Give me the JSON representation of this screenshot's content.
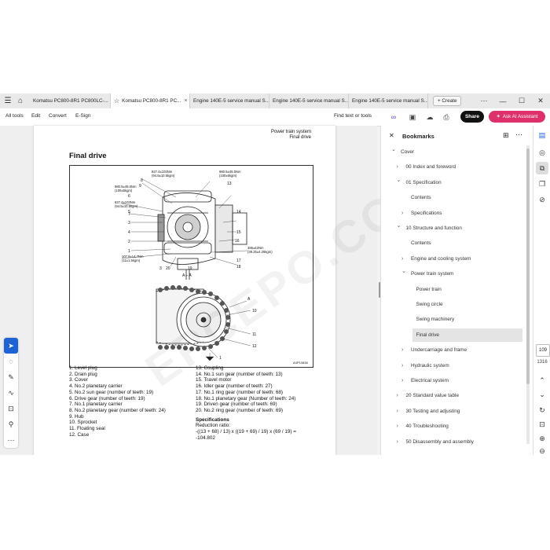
{
  "tabs": [
    {
      "label": "Komatsu PC800-8R1 PC800LC-...",
      "active": false
    },
    {
      "label": "Komatsu PC800-8R1 PC...",
      "active": true
    },
    {
      "label": "Engine 140E-5 service manual S...",
      "active": false
    },
    {
      "label": "Engine 140E-5 service manual S...",
      "active": false
    },
    {
      "label": "Engine 140E-5 service manual S...",
      "active": false
    }
  ],
  "new_tab_label": "+ Create",
  "menu": {
    "all_tools": "All tools",
    "edit": "Edit",
    "convert": "Convert",
    "esign": "E-Sign"
  },
  "find_label": "Find text or tools",
  "share_label": "Share",
  "ai_label": "Ask AI Assistant",
  "page": {
    "header_line1": "Power train system",
    "header_line2": "Final drive",
    "title": "Final drive",
    "watermark": "EPCEPO.COM",
    "figure": {
      "torque_labels": [
        "927.4±103Nm",
        "(94.5±10.5kgm)",
        "980.5±49.5Nm",
        "(100±5kgm)",
        "980.5±49.5Nm",
        "(100±5kgm)",
        "927.4±103Nm",
        "(94.5±10.5kgm)",
        "107.8±14.7Nm",
        "(11±1.5kgm)",
        "385±42Nm",
        "(39.25±4.25kgm)"
      ],
      "callouts": [
        "13",
        "8",
        "9",
        "6",
        "5",
        "7",
        "3",
        "4",
        "2",
        "1",
        "14",
        "15",
        "16",
        "17",
        "18",
        "3",
        "20",
        "19",
        "10",
        "11",
        "12",
        "1"
      ],
      "section_label": "A – A",
      "arrow_label": "A",
      "code": "A4P10838"
    },
    "legend_left": [
      "1. Level plug",
      "2. Drain plug",
      "3. Cover",
      "4. No.2 planetary carrier",
      "5. No.2 sun gear (number of teeth: 19)",
      "6. Drive gear (number of teeth: 19)",
      "7. No.1 planetary carrier",
      "8. No.2 planetary gear (number of teeth: 24)",
      "9. Hub",
      "10. Sprocket",
      "11. Floating seal",
      "12. Case"
    ],
    "legend_right": [
      "13. Coupling",
      "14. No.1 sun gear (number of teeth: 13)",
      "15. Travel motor",
      "16. Idler gear (number of teeth: 27)",
      "17. No.1 ring gear (number of teeth: 68)",
      "18. No.1 planetary gear (Number of teeth: 24)",
      "19. Driven gear (number of teeth: 69)",
      "20. No.2 ring gear (number of teeth: 69)"
    ],
    "spec_title": "Specifications",
    "spec_lines": [
      "Reduction ratio:",
      "-((13 + 68) / 13) x ((19 + 69) / 19) x (69 / 19) =",
      "-104.802"
    ]
  },
  "bookmarks": {
    "title": "Bookmarks",
    "items": [
      {
        "label": "Cover",
        "level": 0,
        "chevron": "down"
      },
      {
        "label": "00 Index and foreword",
        "level": 1,
        "chevron": "right"
      },
      {
        "label": "01 Specification",
        "level": 1,
        "chevron": "down"
      },
      {
        "label": "Contents",
        "level": 2,
        "chevron": ""
      },
      {
        "label": "Specifications",
        "level": 2,
        "chevron": "right"
      },
      {
        "label": "10 Structure and function",
        "level": 1,
        "chevron": "down"
      },
      {
        "label": "Contents",
        "level": 2,
        "chevron": ""
      },
      {
        "label": "Engine and cooling system",
        "level": 2,
        "chevron": "right"
      },
      {
        "label": "Power train system",
        "level": 2,
        "chevron": "down"
      },
      {
        "label": "Power train",
        "level": 3,
        "chevron": ""
      },
      {
        "label": "Swing circle",
        "level": 3,
        "chevron": ""
      },
      {
        "label": "Swing machinery",
        "level": 3,
        "chevron": ""
      },
      {
        "label": "Final drive",
        "level": 3,
        "chevron": "",
        "selected": true
      },
      {
        "label": "Undercarriage and frame",
        "level": 2,
        "chevron": "right"
      },
      {
        "label": "Hydraulic system",
        "level": 2,
        "chevron": "right"
      },
      {
        "label": "Electrical system",
        "level": 2,
        "chevron": "right"
      },
      {
        "label": "20 Standard value table",
        "level": 1,
        "chevron": "right"
      },
      {
        "label": "30 Testing and adjusting",
        "level": 1,
        "chevron": "right"
      },
      {
        "label": "40 Troubleshooting",
        "level": 1,
        "chevron": "right"
      },
      {
        "label": "50 Disassembly and assembly",
        "level": 1,
        "chevron": "right"
      }
    ]
  },
  "pager": {
    "current": "109",
    "total": "1316"
  },
  "colors": {
    "accent": "#1e63d6",
    "ai": "#e0306c",
    "share": "#111111"
  }
}
